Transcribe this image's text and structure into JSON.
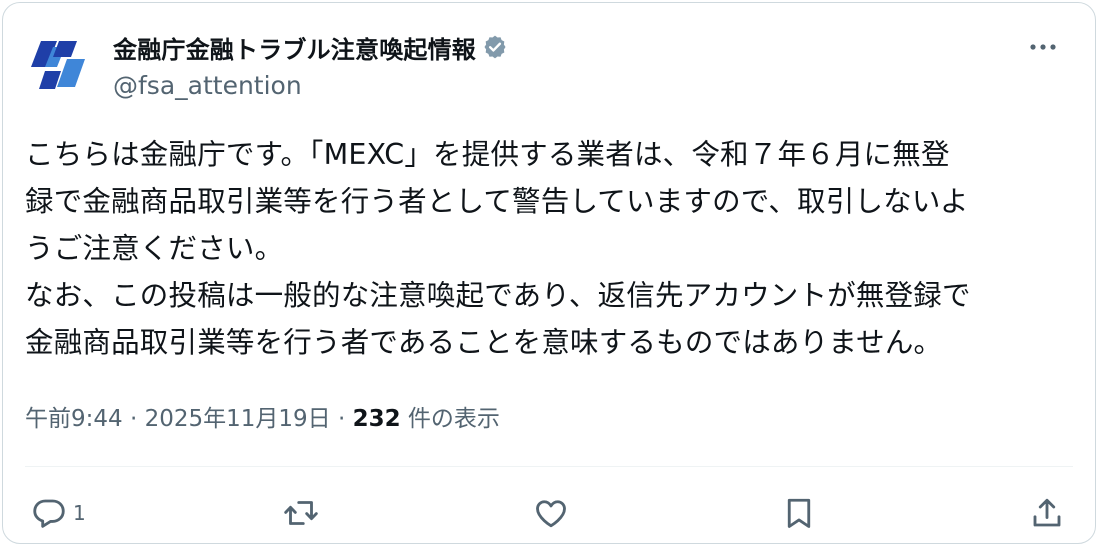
{
  "author": {
    "display_name": "金融庁金融トラブル注意喚起情報",
    "handle": "@fsa_attention",
    "verified": true,
    "verified_color": "#829aab",
    "avatar_icon": "fsa-logo-icon",
    "avatar_colors": [
      "#1f3fa8",
      "#3f86d8"
    ]
  },
  "post": {
    "lines": [
      "こちらは金融庁です。「MEXC」を提供する業者は、令和７年６月に無登",
      "録で金融商品取引業等を行う者として警告していますので、取引しないよ",
      "うご注意ください。",
      "なお、この投稿は一般的な注意喚起であり、返信先アカウントが無登録で",
      "金融商品取引業等を行う者であることを意味するものではありません。"
    ]
  },
  "meta": {
    "time": "午前9:44",
    "separator": " · ",
    "date": "2025年11月19日",
    "views_count": "232",
    "views_label": " 件の表示"
  },
  "actions": {
    "reply_count": "1",
    "icons": [
      "reply-icon",
      "repost-icon",
      "like-icon",
      "bookmark-icon",
      "share-icon"
    ]
  },
  "colors": {
    "text_primary": "#0f1419",
    "text_secondary": "#536471",
    "border": "#cfd9de"
  }
}
